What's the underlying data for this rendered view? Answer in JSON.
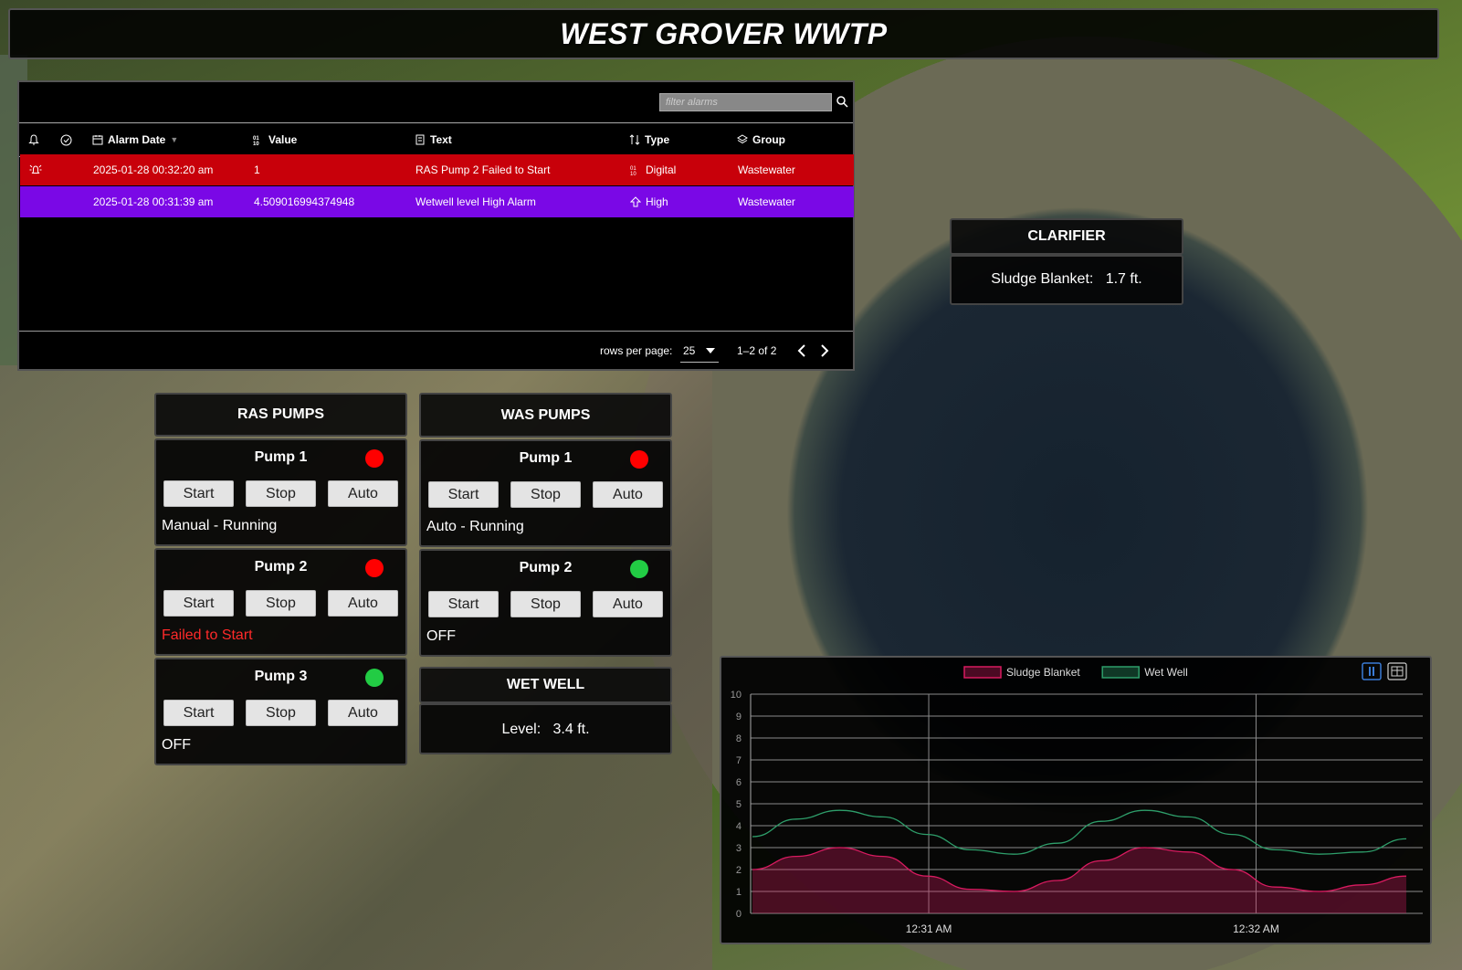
{
  "title": "WEST GROVER WWTP",
  "alarms": {
    "filter_placeholder": "filter alarms",
    "columns": [
      "Alarm Date",
      "Value",
      "Text",
      "Type",
      "Group"
    ],
    "rows": [
      {
        "date": "2025-01-28 00:32:20 am",
        "value": "1",
        "text": "RAS Pump 2 Failed to Start",
        "type": "Digital",
        "group": "Wastewater",
        "color": "#c8000a"
      },
      {
        "date": "2025-01-28 00:31:39 am",
        "value": "4.509016994374948",
        "text": "Wetwell level High Alarm",
        "type": "High",
        "group": "Wastewater",
        "color": "#7a08e6"
      }
    ],
    "rows_per_page_label": "rows per page:",
    "rows_per_page": "25",
    "range": "1–2 of 2"
  },
  "clarifier": {
    "title": "CLARIFIER",
    "label": "Sludge Blanket:",
    "value": "1.7 ft."
  },
  "ras": {
    "title": "RAS PUMPS",
    "pumps": [
      {
        "name": "Pump 1",
        "status": "Manual - Running",
        "led": "#ff0000",
        "status_color": "#ffffff"
      },
      {
        "name": "Pump 2",
        "status": "Failed to Start",
        "led": "#ff0000",
        "status_color": "#ff2a2a"
      },
      {
        "name": "Pump 3",
        "status": "OFF",
        "led": "#22cc44",
        "status_color": "#ffffff"
      }
    ]
  },
  "was": {
    "title": "WAS PUMPS",
    "pumps": [
      {
        "name": "Pump 1",
        "status": "Auto - Running",
        "led": "#ff0000",
        "status_color": "#ffffff"
      },
      {
        "name": "Pump 2",
        "status": "OFF",
        "led": "#22cc44",
        "status_color": "#ffffff"
      }
    ]
  },
  "buttons": {
    "start": "Start",
    "stop": "Stop",
    "auto": "Auto"
  },
  "wetwell": {
    "title": "WET WELL",
    "label": "Level:",
    "value": "3.4 ft."
  },
  "chart_data": {
    "type": "area",
    "ylim": [
      0,
      10
    ],
    "yticks": [
      "0",
      "1",
      "2",
      "3",
      "4",
      "5",
      "6",
      "7",
      "8",
      "9",
      "10"
    ],
    "xticks": [
      "12:31 AM",
      "12:32 AM"
    ],
    "legend": "top-center",
    "grid": true,
    "series": [
      {
        "name": "Sludge Blanket",
        "color": "#d81b60",
        "values": [
          2.0,
          2.6,
          3.0,
          2.6,
          1.7,
          1.1,
          1.0,
          1.5,
          2.4,
          3.0,
          2.8,
          2.0,
          1.2,
          1.0,
          1.3,
          1.7
        ]
      },
      {
        "name": "Wet Well",
        "color": "#2e9e6a",
        "values": [
          3.5,
          4.3,
          4.7,
          4.4,
          3.6,
          2.9,
          2.7,
          3.2,
          4.2,
          4.7,
          4.4,
          3.6,
          2.9,
          2.7,
          2.8,
          3.4
        ]
      }
    ]
  }
}
